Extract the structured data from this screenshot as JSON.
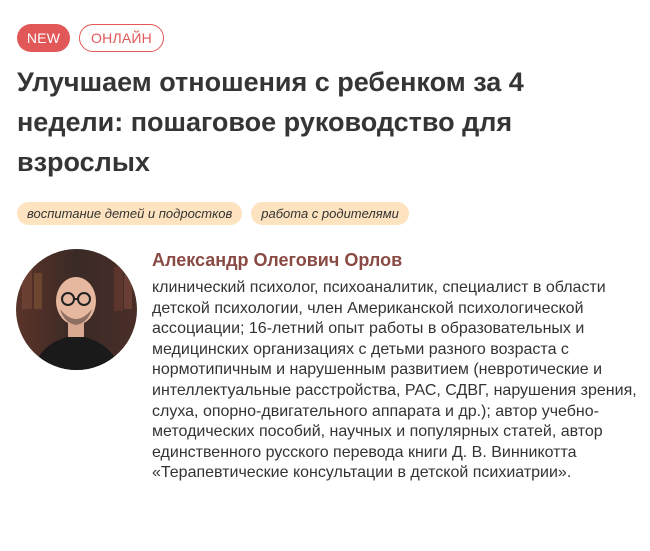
{
  "badges": {
    "new": "NEW",
    "format": "ОНЛАЙН"
  },
  "course": {
    "title": "Улучшаем отношения с ребенком за 4 недели: пошаговое руководство для взрослых"
  },
  "tags": [
    "воспитание детей и подростков",
    "работа с родителями"
  ],
  "author": {
    "name": "Александр Олегович Орлов",
    "bio": "клинический психолог, психоаналитик, специалист в области детской психологии, член Американской психологической ассоциации; 16-летний опыт работы в образовательных и медицинских организациях с детьми разного возраста с нормотипичным и нарушенным развитием (невротические и интеллектуальные расстройства, РАС, СДВГ, нарушения зрения, слуха, опорно-двигательного аппарата и др.); автор учебно-методических пособий, научных и популярных статей, автор единственного русского перевода книги Д. В. Винникотта «Терапевтические консультации в детской психиатрии»."
  },
  "colors": {
    "accent": "#e25757",
    "tag_bg": "#fde3bf",
    "author_name": "#8a4a44"
  }
}
